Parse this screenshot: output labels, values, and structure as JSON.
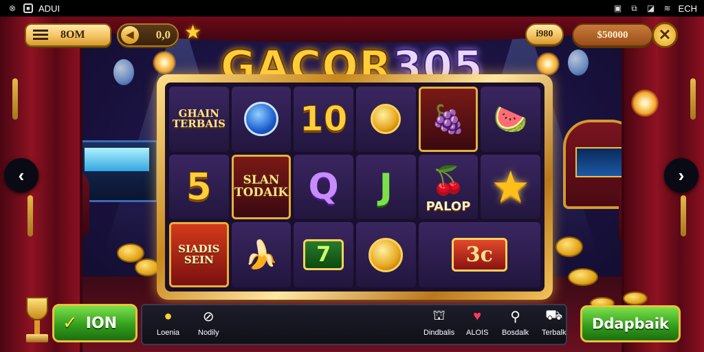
{
  "status_bar": {
    "app_name": "ADUI",
    "time": "ECH"
  },
  "hud": {
    "menu_value": "8OM",
    "score_value": "0,0",
    "coins_value": "i980",
    "balance_value": "$50000",
    "close_symbol": "✕"
  },
  "logo": {
    "part_a": "GACOR",
    "part_b": "305"
  },
  "reels": {
    "r0c0": "GHAIN TERBAIS",
    "r0c2": "10",
    "r1c0": "5",
    "r1c1": "SLAN TODAIK",
    "r1c2": "Q",
    "r1c3": "J",
    "r1c4": "PALOP",
    "r2c0": "SIADIS SEIN",
    "r2c2": "7",
    "r2c4": "3c"
  },
  "nav": {
    "arrow_left": "‹",
    "arrow_right": "›",
    "win_button": "ION",
    "items": [
      {
        "label": "Loenia"
      },
      {
        "label": "Nodily"
      },
      {
        "label": "Dindbalis"
      },
      {
        "label": "ALOIS"
      },
      {
        "label": "Bosdalk"
      },
      {
        "label": "Terbalk"
      }
    ],
    "download_button": "Ddapbaik"
  },
  "colors": {
    "accent_gold": "#f2c463",
    "button_green": "#2f9a1a",
    "curtain_red": "#8e1222"
  }
}
